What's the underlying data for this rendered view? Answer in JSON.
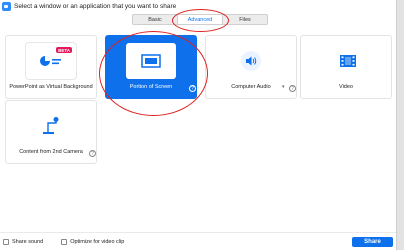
{
  "window": {
    "title": "Select a window or an application that you want to share"
  },
  "tabs": [
    {
      "label": "Basic",
      "active": false
    },
    {
      "label": "Advanced",
      "active": true
    },
    {
      "label": "Files",
      "active": false
    }
  ],
  "tiles": {
    "powerpoint": {
      "label": "PowerPoint as Virtual Background",
      "badge": "BETA"
    },
    "portion": {
      "label": "Portion of Screen"
    },
    "audio": {
      "label": "Computer Audio"
    },
    "video": {
      "label": "Video"
    },
    "camera": {
      "label": "Content from 2nd Camera"
    }
  },
  "footer": {
    "share_sound_label": "Share sound",
    "optimize_label": "Optimize for video clip",
    "share_button": "Share"
  },
  "help_glyph": "?",
  "colors": {
    "accent": "#0e71eb",
    "annotation": "#e02020",
    "beta": "#e4195a"
  },
  "icons": [
    "zoom-app-icon",
    "ppt-pie-icon",
    "portion-screen-icon",
    "speaker-icon",
    "film-icon",
    "camera-stand-icon"
  ]
}
